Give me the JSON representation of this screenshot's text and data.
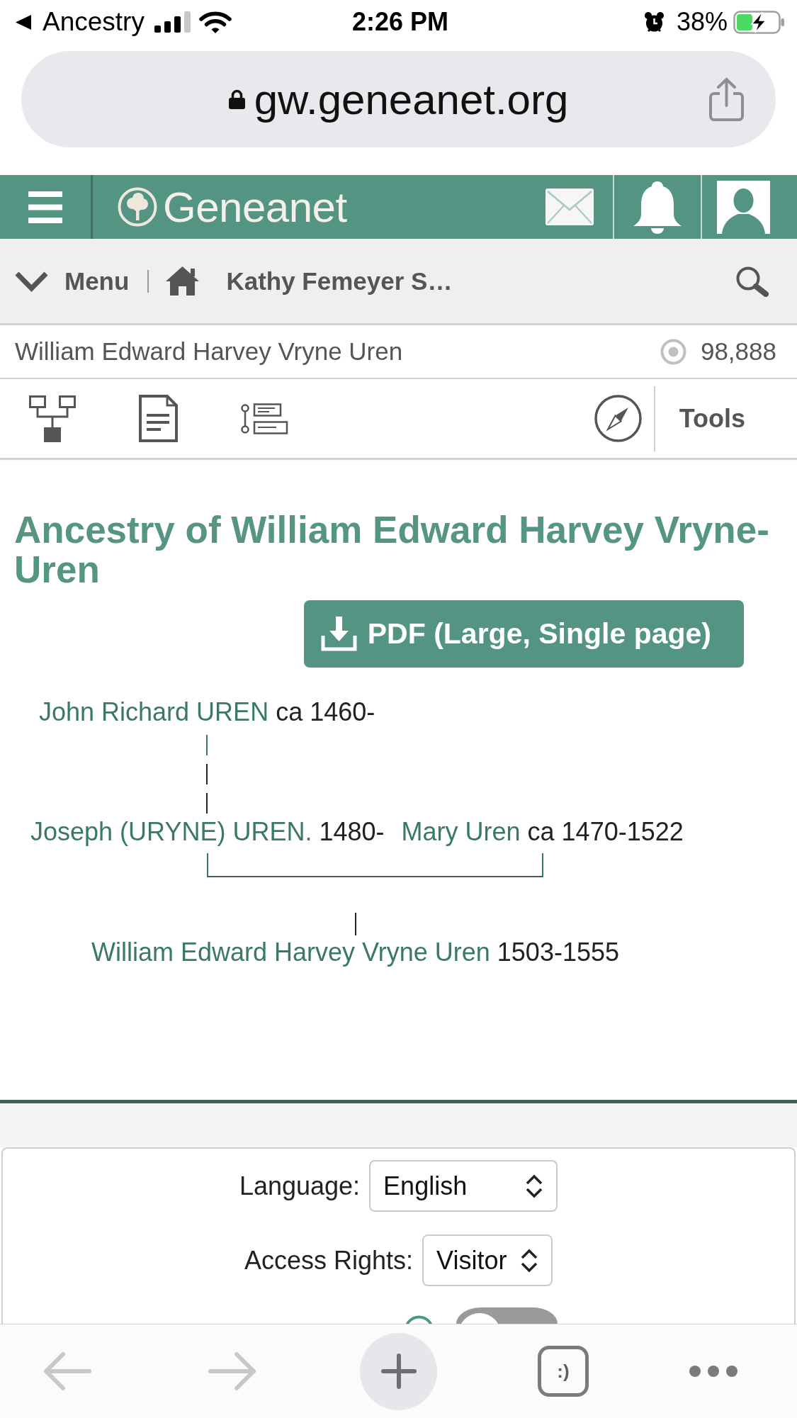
{
  "status_bar": {
    "back_label": "Ancestry",
    "time": "2:26 PM",
    "battery": "38%"
  },
  "address_bar": {
    "url": "gw.geneanet.org"
  },
  "site_header": {
    "logo": "Geneanet"
  },
  "nav_bar": {
    "menu": "Menu",
    "breadcrumb": "Kathy Femeyer S…"
  },
  "person_bar": {
    "name": "William Edward Harvey Vryne Uren",
    "count": "98,888"
  },
  "view_toolbar": {
    "tools": "Tools"
  },
  "page": {
    "title": "Ancestry of William Edward Harvey Vryne-Uren",
    "pdf_button": "PDF (Large, Single page)"
  },
  "tree": {
    "generations": [
      {
        "people": [
          {
            "name": "John Richard UREN",
            "dates": "ca 1460-"
          }
        ]
      },
      {
        "people": [
          {
            "name": "Joseph (URYNE) UREN.",
            "dates": "1480-"
          },
          {
            "name": "Mary Uren",
            "dates": "ca 1470-1522"
          }
        ]
      },
      {
        "people": [
          {
            "name": "William Edward Harvey Vryne Uren",
            "dates": "1503-1555"
          }
        ]
      }
    ]
  },
  "footer": {
    "settings": [
      {
        "label": "Language:",
        "value": "English"
      },
      {
        "label": "Access Rights:",
        "value": "Visitor"
      }
    ],
    "toggle": {
      "on": false
    }
  },
  "browser_toolbar": {
    "tabs_label": ":)"
  }
}
